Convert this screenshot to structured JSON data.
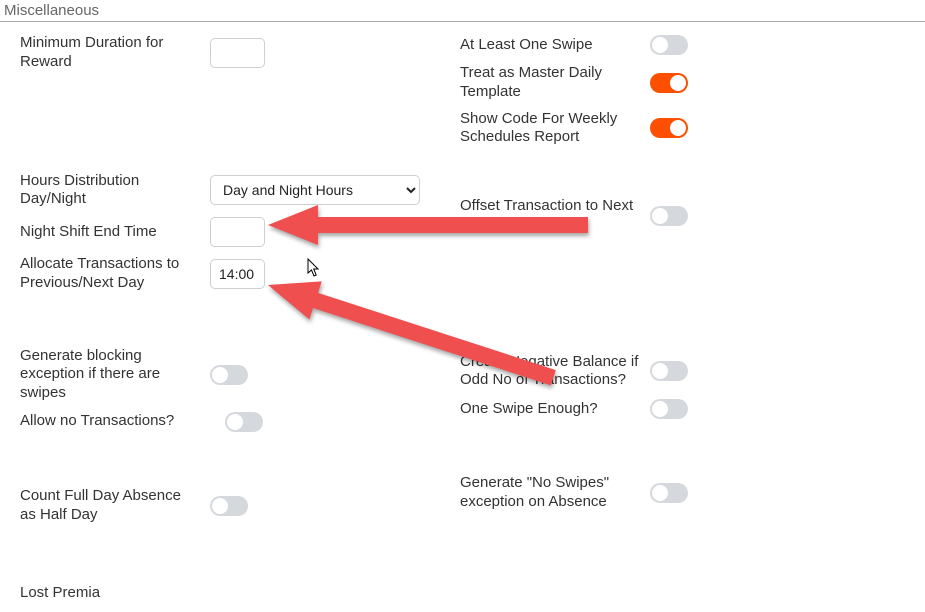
{
  "section": {
    "title": "Miscellaneous"
  },
  "left": {
    "min_duration_label": "Minimum Duration for Reward",
    "min_duration_value": "",
    "hours_dist_label": "Hours Distribution Day/Night",
    "hours_dist_value": "Day and Night Hours",
    "night_shift_label": "Night Shift End Time",
    "night_shift_value": "",
    "alloc_trans_label": "Allocate Transactions to Previous/Next Day",
    "alloc_trans_value": "14:00",
    "gen_block_label": "Generate blocking exception if there are swipes",
    "allow_no_trans_label": "Allow no Transactions?",
    "count_full_label": "Count Full Day Absence as Half Day",
    "lost_premia_label": "Lost Premia"
  },
  "right": {
    "at_least_swipe_label": "At Least One Swipe",
    "treat_master_label": "Treat as Master Daily Template",
    "show_code_label": "Show Code For Weekly Schedules Report",
    "offset_trans_label": "Offset Transaction to Next Day",
    "create_neg_label": "Create Negative Balance if Odd No of Transactions?",
    "one_swipe_label": "One Swipe Enough?",
    "gen_no_swipes_label": "Generate \"No Swipes\" exception on Absence"
  }
}
